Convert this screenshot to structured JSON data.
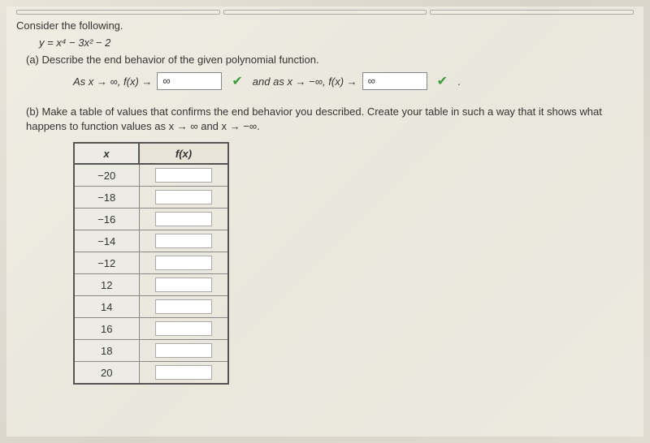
{
  "top_bar_count": 3,
  "prompt": "Consider the following.",
  "equation": "y = x⁴ − 3x² − 2",
  "part_a": {
    "label": "(a) Describe the end behavior of the given polynomial function.",
    "as_text1": "As  x → ∞, f(x) →",
    "answer1": "∞",
    "and_as": "and as x → −∞, f(x) →",
    "answer2": "∞",
    "period": "."
  },
  "part_b": {
    "text": "(b) Make a table of values that confirms the end behavior you described. Create your table in such a way that it shows what happens to function values as  x → ∞  and  x → −∞.",
    "table": {
      "header_x": "x",
      "header_fx": "f(x)",
      "rows": [
        {
          "x": "−20",
          "fx": ""
        },
        {
          "x": "−18",
          "fx": ""
        },
        {
          "x": "−16",
          "fx": ""
        },
        {
          "x": "−14",
          "fx": ""
        },
        {
          "x": "−12",
          "fx": ""
        },
        {
          "x": "12",
          "fx": ""
        },
        {
          "x": "14",
          "fx": ""
        },
        {
          "x": "16",
          "fx": ""
        },
        {
          "x": "18",
          "fx": ""
        },
        {
          "x": "20",
          "fx": ""
        }
      ]
    }
  }
}
